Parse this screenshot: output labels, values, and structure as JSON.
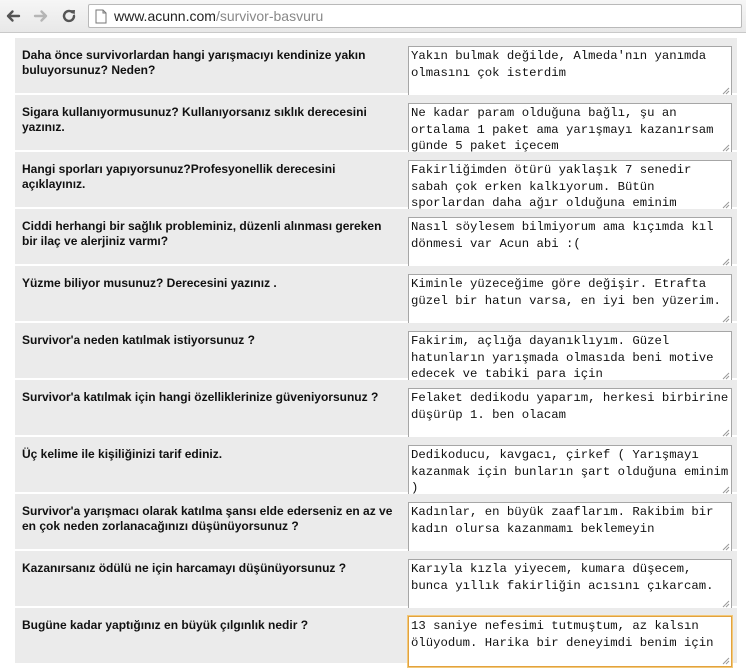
{
  "browser": {
    "url_host": "www.acunn.com",
    "url_path": "/survivor-basvuru"
  },
  "form": {
    "rows": [
      {
        "question": "Daha önce survivorlardan hangi yarışmacıyı kendinize yakın buluyorsunuz? Neden?",
        "answer": "Yakın bulmak değilde, Almeda'nın yanımda olmasını çok isterdim"
      },
      {
        "question": "Sigara kullanıyormusunuz? Kullanıyorsanız sıklık derecesini yazınız.",
        "answer": "Ne kadar param olduğuna bağlı, şu an ortalama 1 paket ama yarışmayı kazanırsam günde 5 paket içecem"
      },
      {
        "question": "Hangi sporları yapıyorsunuz?Profesyonellik derecesini açıklayınız.",
        "answer": "Fakirliğimden ötürü yaklaşık 7 senedir sabah çok erken kalkıyorum. Bütün sporlardan daha ağır olduğuna eminim"
      },
      {
        "question": "Ciddi herhangi bir sağlık probleminiz, düzenli alınması gereken bir ilaç ve alerjiniz varmı?",
        "answer": "Nasıl söylesem bilmiyorum ama kıçımda kıl dönmesi var Acun abi :("
      },
      {
        "question": "Yüzme biliyor musunuz? Derecesini yazınız .",
        "answer": "Kiminle yüzeceğime göre değişir. Etrafta güzel bir hatun varsa, en iyi ben yüzerim."
      },
      {
        "question": "Survivor'a neden katılmak istiyorsunuz ?",
        "answer": "Fakirim, açlığa dayanıklıyım. Güzel hatunların yarışmada olmasıda beni motive edecek ve tabiki para için"
      },
      {
        "question": "Survivor'a katılmak için hangi özelliklerinize güveniyorsunuz ?",
        "answer": "Felaket dedikodu yaparım, herkesi birbirine düşürüp 1. ben olacam"
      },
      {
        "question": "Üç kelime ile kişiliğinizi tarif ediniz.",
        "answer": "Dedikoducu, kavgacı, çirkef ( Yarışmayı kazanmak için bunların şart olduğuna eminim )"
      },
      {
        "question": "Survivor'a yarışmacı olarak katılma şansı elde ederseniz en az ve en çok neden zorlanacağınızı düşünüyorsunuz ?",
        "answer": "Kadınlar, en büyük zaaflarım. Rakibim bir kadın olursa kazanmamı beklemeyin"
      },
      {
        "question": "Kazanırsanız ödülü ne için harcamayı düşünüyorsunuz ?",
        "answer": "Karıyla kızla yiyecem, kumara düşecem, bunca yıllık fakirliğin acısını çıkarcam."
      },
      {
        "question": "Bugüne kadar yaptığınız en büyük çılgınlık nedir ?",
        "answer": "13 saniye nefesimi tutmuştum, az kalsın ölüyodum. Harika bir deneyimdi benim için"
      }
    ]
  }
}
